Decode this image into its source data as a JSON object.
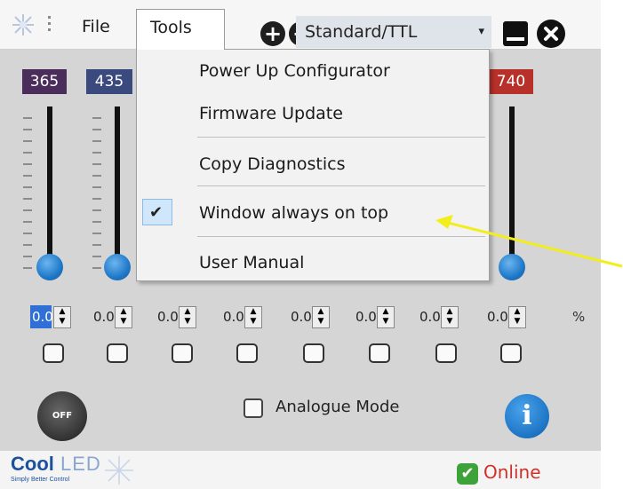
{
  "menubar": {
    "file_label": "File",
    "tools_label": "Tools",
    "plus_label": "+",
    "minus_label": "−",
    "mode_select": "Standard/TTL",
    "caret": "▾"
  },
  "tools_menu": {
    "items": [
      {
        "label": "Power Up Configurator",
        "checked": false
      },
      {
        "label": "Firmware Update",
        "checked": false
      },
      {
        "label": "Copy Diagnostics",
        "checked": false
      },
      {
        "label": "Window always on top",
        "checked": true
      },
      {
        "label": "User Manual",
        "checked": false
      }
    ],
    "check_glyph": "✔"
  },
  "channels": {
    "wavelengths": [
      {
        "label": "365",
        "color": "#4b2d5c"
      },
      {
        "label": "435",
        "color": "#3b4a7e"
      },
      {
        "label": "740",
        "color": "#b8302a"
      }
    ],
    "intensities": [
      "0.0",
      "0.0",
      "0.0",
      "0.0",
      "0.0",
      "0.0",
      "0.0",
      "0.0"
    ],
    "unit": "%",
    "spin_glyph": "▲▼"
  },
  "controls": {
    "off_label": "OFF",
    "analogue_label": "Analogue Mode",
    "info_label": "i"
  },
  "status": {
    "logo_cool": "Cool",
    "logo_led": "LED",
    "logo_tagline": "Simply Better Control",
    "online_label": "Online",
    "online_glyph": "✔"
  },
  "colors": {
    "panel_bg": "#d5d5d5",
    "accent_blue": "#1f79c9",
    "online_red": "#d0302a",
    "arrow_yellow": "#f2ee1c"
  }
}
